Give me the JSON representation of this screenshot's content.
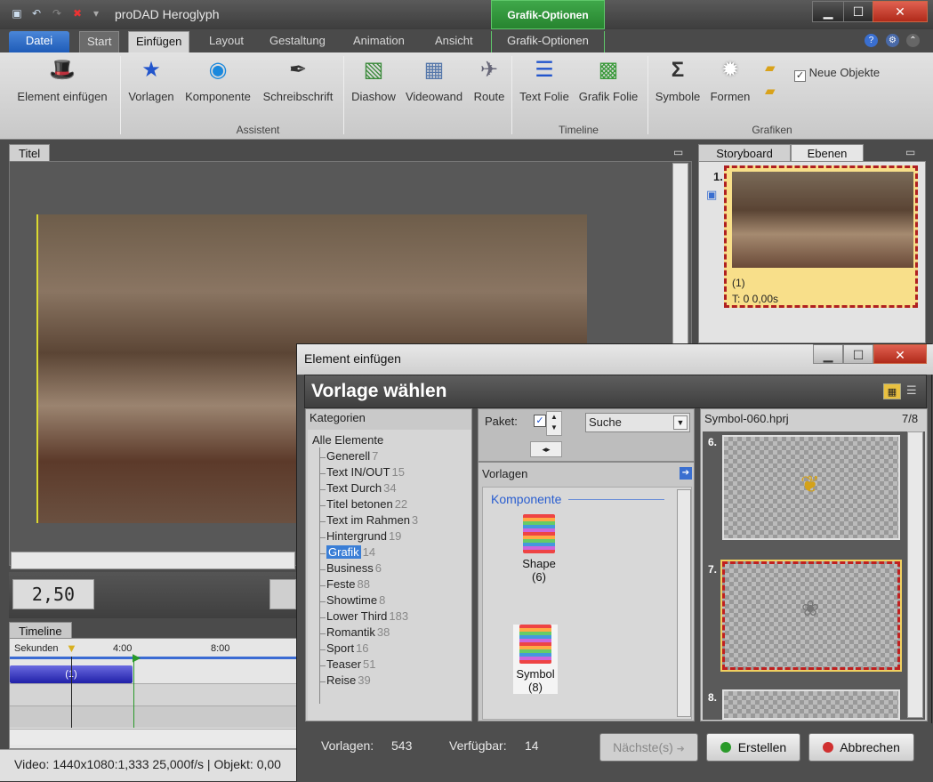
{
  "app": {
    "title": "proDAD Heroglyph",
    "context_tab_header": "Grafik-Optionen"
  },
  "tabs": [
    {
      "label": "Datei"
    },
    {
      "label": "Start"
    },
    {
      "label": "Einfügen"
    },
    {
      "label": "Layout"
    },
    {
      "label": "Gestaltung"
    },
    {
      "label": "Animation"
    },
    {
      "label": "Ansicht"
    },
    {
      "label": "Grafik-Optionen"
    }
  ],
  "ribbon": {
    "element_einfuegen": "Element einfügen",
    "vorlagen": "Vorlagen",
    "komponente": "Komponente",
    "schreibschrift": "Schreibschrift",
    "diashow": "Diashow",
    "videowand": "Videowand",
    "route": "Route",
    "text_folie": "Text Folie",
    "grafik_folie": "Grafik Folie",
    "symbole": "Symbole",
    "formen": "Formen",
    "neue_objekte": "Neue Objekte",
    "group_assistent": "Assistent",
    "group_timeline": "Timeline",
    "group_grafiken": "Grafiken"
  },
  "panels": {
    "titel_tab": "Titel",
    "storyboard_tab": "Storyboard",
    "ebenen_tab": "Ebenen",
    "timeline_tab": "Timeline",
    "time_value": "2,50",
    "timeline_unit": "Sekunden",
    "tick_1": "4:00",
    "tick_2": "8:00",
    "clip_label": "(1)",
    "status_text": "Video: 1440x1080:1,333  25,000f/s | Objekt: 0,00"
  },
  "storyboard": {
    "index": "1.",
    "label": "(1)",
    "time": "T: 0  0,00s"
  },
  "dialog": {
    "window_title": "Element einfügen",
    "heading": "Vorlage wählen",
    "categories_header": "Kategorien",
    "root_category": "Alle Elemente",
    "categories": [
      {
        "name": "Generell",
        "count": "7"
      },
      {
        "name": "Text IN/OUT",
        "count": "15"
      },
      {
        "name": "Text Durch",
        "count": "34"
      },
      {
        "name": "Titel betonen",
        "count": "22"
      },
      {
        "name": "Text im Rahmen",
        "count": "3"
      },
      {
        "name": "Hintergrund",
        "count": "19"
      },
      {
        "name": "Grafik",
        "count": "14"
      },
      {
        "name": "Business",
        "count": "6"
      },
      {
        "name": "Feste",
        "count": "88"
      },
      {
        "name": "Showtime",
        "count": "8"
      },
      {
        "name": "Lower Third",
        "count": "183"
      },
      {
        "name": "Romantik",
        "count": "38"
      },
      {
        "name": "Sport",
        "count": "16"
      },
      {
        "name": "Teaser",
        "count": "51"
      },
      {
        "name": "Reise",
        "count": "39"
      }
    ],
    "selected_category": "Grafik",
    "paket_label": "Paket:",
    "search_select": "Suche",
    "vorlagen_header": "Vorlagen",
    "group_komponente": "Komponente",
    "item_shape": "Shape",
    "item_shape_count": "(6)",
    "item_symbol": "Symbol",
    "item_symbol_count": "(8)",
    "right_header_file": "Symbol-060.hprj",
    "right_header_pos": "7/8",
    "thumb_6": "6.",
    "thumb_7": "7.",
    "thumb_8": "8.",
    "footer_vorlagen_label": "Vorlagen:",
    "footer_vorlagen_value": "543",
    "footer_verfuegbar_label": "Verfügbar:",
    "footer_verfuegbar_value": "14",
    "btn_next": "Nächste(s)",
    "btn_create": "Erstellen",
    "btn_cancel": "Abbrechen"
  },
  "colors": {
    "accent_blue": "#3a7ed6",
    "context_green": "#2f9a3a",
    "selection_red": "#b02020",
    "selection_fill": "#f8df8a"
  }
}
